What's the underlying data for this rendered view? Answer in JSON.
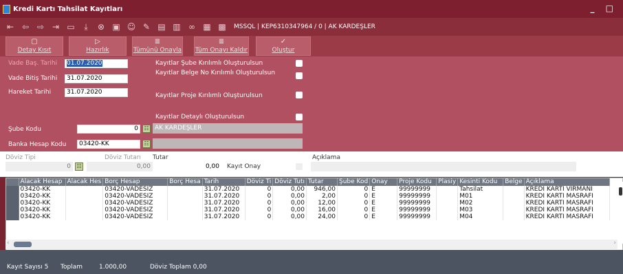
{
  "window": {
    "title": "Kredi Kartı Tahsilat Kayıtları",
    "controls": "_ □"
  },
  "toolbar": {
    "icons": [
      "first-icon",
      "prev-icon",
      "next-icon",
      "last-icon",
      "list-icon",
      "download-icon",
      "cancel-icon",
      "calendar-icon",
      "user-icon",
      "edit-icon",
      "filter-icon",
      "document-icon",
      "link-icon",
      "lock-icon",
      "grid-icon"
    ],
    "info": "MSSQL | KEP6310347964 / 0 | AK KARDEŞLER"
  },
  "actions": [
    {
      "label": "Detay Kısıt",
      "icon": "▢"
    },
    {
      "label": "Hazırlık",
      "icon": "▷"
    },
    {
      "label": "Tümünü Onayla",
      "icon": "≣"
    },
    {
      "label": "Tüm Onayı Kaldır",
      "icon": "≣"
    },
    {
      "label": "Oluştur",
      "icon": "✓"
    }
  ],
  "form": {
    "vade_bas_label": "Vade Baş. Tarihi",
    "vade_bas_value": "01.07.2020",
    "vade_bit_label": "Vade Bitiş Tarihi",
    "vade_bit_value": "31.07.2020",
    "hareket_label": "Hareket Tarihi",
    "hareket_value": "31.07.2020",
    "opt_sube": "Kayıtlar Şube Kırılımlı Oluşturulsun",
    "opt_belge": "Kayıtlar Belge No Kırılımlı Oluşturulsun",
    "opt_proje": "Kayıtlar Proje Kırılımlı Oluşturulsun",
    "opt_detayli": "Kayıtlar Detaylı Oluşturulsun",
    "sube_label": "Şube Kodu",
    "sube_value": "0",
    "sube_name": "AK KARDEŞLER",
    "banka_label": "Banka Hesap Kodu",
    "banka_value": "03420-KK",
    "banka_name": ""
  },
  "doviz": {
    "tip_label": "Döviz Tipi",
    "tip_value": "0",
    "tutari_label": "Döviz Tutarı",
    "tutari_value": "0,00",
    "tutar_label": "Tutar",
    "tutar_value": "0,00",
    "kayit_onay_label": "Kayıt Onay",
    "aciklama_label": "Açıklama",
    "aciklama_value": ""
  },
  "grid": {
    "columns": [
      "Alacak Hesap",
      "Alacak Hes",
      "Borç Hesap",
      "Borç Hesa",
      "Tarih",
      "Döviz Ti",
      "Döviz Tutı",
      "Tutar",
      "Şube Kod",
      "Onay",
      "Proje Kodu",
      "Plasiy",
      "Kesinti Kodu",
      "Belge",
      "Açıklama"
    ],
    "rows": [
      [
        "03420-KK",
        "",
        "03420-VADESIZ",
        "",
        "31.07.2020",
        "0",
        "0,00",
        "946,00",
        "0",
        "E",
        "99999999",
        "",
        "Tahsilat",
        "",
        "KREDİ KARTI VİRMANI"
      ],
      [
        "03420-KK",
        "",
        "03420-VADESIZ",
        "",
        "31.07.2020",
        "0",
        "0,00",
        "2,00",
        "0",
        "E",
        "99999999",
        "",
        "M01",
        "",
        "KREDİ KARTI MASRAFI"
      ],
      [
        "03420-KK",
        "",
        "03420-VADESIZ",
        "",
        "31.07.2020",
        "0",
        "0,00",
        "12,00",
        "0",
        "E",
        "99999999",
        "",
        "M02",
        "",
        "KREDİ KARTI MASRAFI"
      ],
      [
        "03420-KK",
        "",
        "03420-VADESIZ",
        "",
        "31.07.2020",
        "0",
        "0,00",
        "16,00",
        "0",
        "E",
        "99999999",
        "",
        "M03",
        "",
        "KREDİ KARTI MASRAFI"
      ],
      [
        "03420-KK",
        "",
        "03420-VADESIZ",
        "",
        "31.07.2020",
        "0",
        "0,00",
        "24,00",
        "0",
        "E",
        "99999999",
        "",
        "M04",
        "",
        "KREDİ KARTI MASRAFI"
      ]
    ]
  },
  "status": {
    "kayit": "Kayıt Sayısı 5",
    "toplam_label": "Toplam",
    "toplam_value": "1.000,00",
    "doviz_toplam": "Döviz Toplam 0,00"
  }
}
